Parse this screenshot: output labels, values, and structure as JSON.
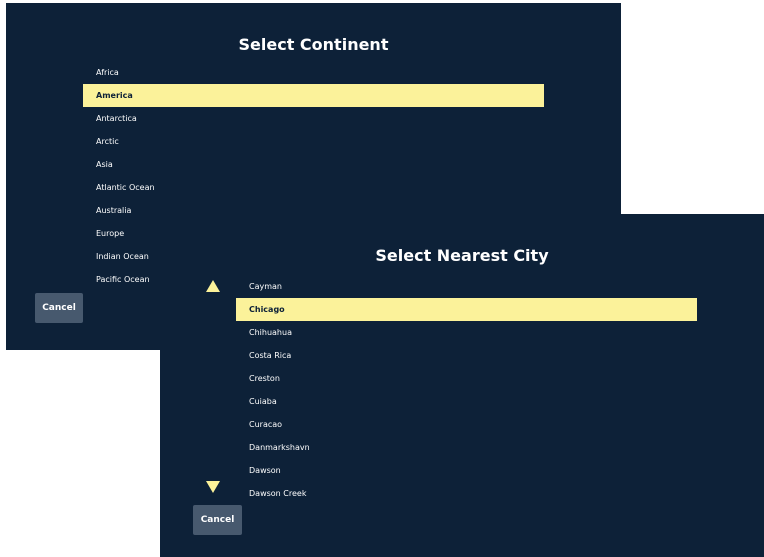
{
  "colors": {
    "panel_bg": "#0d2138",
    "highlight": "#fbf29a",
    "button_bg": "#47596e",
    "text": "#ffffff",
    "arrow": "#fbf29a"
  },
  "continent_dialog": {
    "title": "Select Continent",
    "items": [
      {
        "label": "Africa",
        "selected": false
      },
      {
        "label": "America",
        "selected": true
      },
      {
        "label": "Antarctica",
        "selected": false
      },
      {
        "label": "Arctic",
        "selected": false
      },
      {
        "label": "Asia",
        "selected": false
      },
      {
        "label": "Atlantic Ocean",
        "selected": false
      },
      {
        "label": "Australia",
        "selected": false
      },
      {
        "label": "Europe",
        "selected": false
      },
      {
        "label": "Indian Ocean",
        "selected": false
      },
      {
        "label": "Pacific Ocean",
        "selected": false
      }
    ],
    "cancel_label": "Cancel"
  },
  "city_dialog": {
    "title": "Select Nearest City",
    "scroll_up_icon": "triangle-up-icon",
    "scroll_down_icon": "triangle-down-icon",
    "items": [
      {
        "label": "Cayman",
        "selected": false
      },
      {
        "label": "Chicago",
        "selected": true
      },
      {
        "label": "Chihuahua",
        "selected": false
      },
      {
        "label": "Costa Rica",
        "selected": false
      },
      {
        "label": "Creston",
        "selected": false
      },
      {
        "label": "Cuiaba",
        "selected": false
      },
      {
        "label": "Curacao",
        "selected": false
      },
      {
        "label": "Danmarkshavn",
        "selected": false
      },
      {
        "label": "Dawson",
        "selected": false
      },
      {
        "label": "Dawson Creek",
        "selected": false
      }
    ],
    "cancel_label": "Cancel"
  }
}
